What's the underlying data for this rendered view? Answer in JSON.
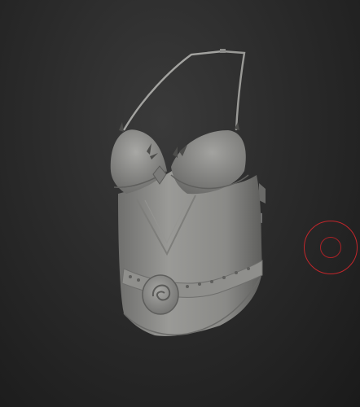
{
  "viewport": {
    "background_color": "#2b2b2b",
    "model_name": "corset-sculpt",
    "material_color": "#8e8e8c"
  },
  "brush": {
    "cursor_color": "#c2262b",
    "cursor_icon": "brush-radius-circle-icon"
  }
}
